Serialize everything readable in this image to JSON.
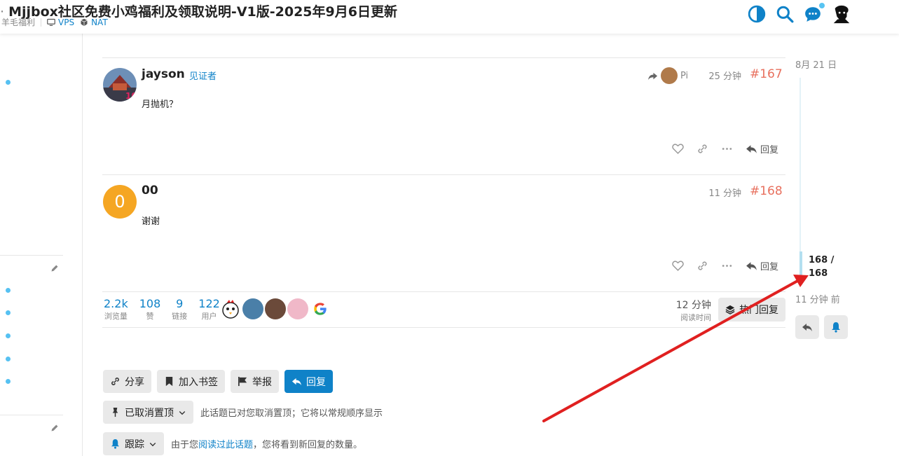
{
  "header": {
    "title": "Mjjbox社区免费小鸡福利及领取说明-V1版-2025年9月6日更新",
    "category": "羊毛福利",
    "tags": [
      "VPS",
      "NAT"
    ],
    "icons": [
      "theme-toggle-icon",
      "search-icon",
      "chat-icon",
      "user-avatar"
    ]
  },
  "posts": [
    {
      "username": "jayson",
      "badge": "见证者",
      "body": "月抛机？",
      "reply_to": "Pi",
      "time": "25 分钟",
      "number": "#167",
      "reply_label": "回复"
    },
    {
      "username": "00",
      "avatar_letter": "0",
      "avatar_color": "#f5a623",
      "body": "谢谢",
      "time": "11 分钟",
      "number": "#168",
      "reply_label": "回复"
    }
  ],
  "topic_map": {
    "stats": [
      {
        "value": "2.2k",
        "label": "浏览量"
      },
      {
        "value": "108",
        "label": "赞"
      },
      {
        "value": "9",
        "label": "链接"
      },
      {
        "value": "122",
        "label": "用户"
      }
    ],
    "read_time_value": "12 分钟",
    "read_time_label": "阅读时间",
    "hot_label": "热门回复"
  },
  "footer_buttons": {
    "share": "分享",
    "bookmark": "加入书签",
    "flag": "举报",
    "reply": "回复"
  },
  "pin": {
    "button": "已取消置顶",
    "text": "此话题已对您取消置顶；它将以常规顺序显示"
  },
  "tracking": {
    "button": "跟踪",
    "text_before": "由于您",
    "link": "阅读过此话题",
    "text_after": "，您将看到新回复的数量。"
  },
  "timeline": {
    "date": "8月 21 日",
    "position": "168 /",
    "total": "168",
    "ago": "11 分钟 前"
  },
  "colors": {
    "accent": "#0f82c8",
    "post_number": "#e8705e",
    "annotation_arrow": "#e02020"
  }
}
